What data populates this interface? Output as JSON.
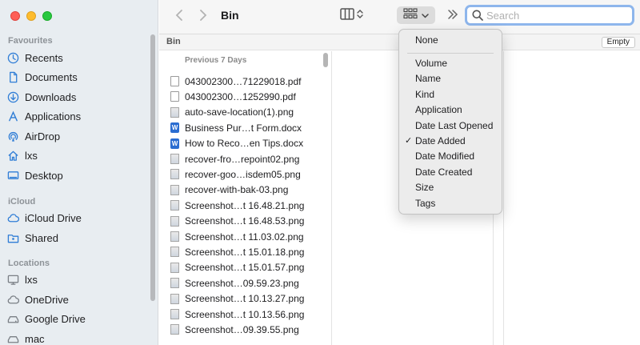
{
  "window": {
    "title": "Bin"
  },
  "sidebar": {
    "sections": [
      {
        "title": "Favourites",
        "items": [
          {
            "label": "Recents",
            "icon": "clock-icon"
          },
          {
            "label": "Documents",
            "icon": "document-icon"
          },
          {
            "label": "Downloads",
            "icon": "download-icon"
          },
          {
            "label": "Applications",
            "icon": "applications-icon"
          },
          {
            "label": "AirDrop",
            "icon": "airdrop-icon"
          },
          {
            "label": "lxs",
            "icon": "home-icon"
          },
          {
            "label": "Desktop",
            "icon": "desktop-icon"
          }
        ]
      },
      {
        "title": "iCloud",
        "items": [
          {
            "label": "iCloud Drive",
            "icon": "cloud-icon"
          },
          {
            "label": "Shared",
            "icon": "shared-folder-icon"
          }
        ]
      },
      {
        "title": "Locations",
        "items": [
          {
            "label": "lxs",
            "icon": "computer-icon"
          },
          {
            "label": "OneDrive",
            "icon": "cloud-icon"
          },
          {
            "label": "Google Drive",
            "icon": "drive-icon"
          },
          {
            "label": "mac",
            "icon": "disk-icon"
          }
        ]
      }
    ]
  },
  "toolbar": {
    "search_placeholder": "Search",
    "search_value": ""
  },
  "pathbar": {
    "label": "Bin",
    "empty_button": "Empty"
  },
  "file_list": {
    "group_header": "Previous 7 Days",
    "files": [
      {
        "name": "043002300…71229018.pdf",
        "type": "pdf"
      },
      {
        "name": "043002300…1252990.pdf",
        "type": "pdf"
      },
      {
        "name": "auto-save-location(1).png",
        "type": "img"
      },
      {
        "name": "Business Pur…t Form.docx",
        "type": "word"
      },
      {
        "name": "How to Reco…en Tips.docx",
        "type": "word"
      },
      {
        "name": "recover-fro…repoint02.png",
        "type": "img"
      },
      {
        "name": "recover-goo…isdem05.png",
        "type": "img"
      },
      {
        "name": "recover-with-bak-03.png",
        "type": "img"
      },
      {
        "name": "Screenshot…t 16.48.21.png",
        "type": "img"
      },
      {
        "name": "Screenshot…t 16.48.53.png",
        "type": "img"
      },
      {
        "name": "Screenshot…t 11.03.02.png",
        "type": "img"
      },
      {
        "name": "Screenshot…t 15.01.18.png",
        "type": "img"
      },
      {
        "name": "Screenshot…t 15.01.57.png",
        "type": "img"
      },
      {
        "name": "Screenshot…09.59.23.png",
        "type": "img"
      },
      {
        "name": "Screenshot…t 10.13.27.png",
        "type": "img"
      },
      {
        "name": "Screenshot…t 10.13.56.png",
        "type": "img"
      },
      {
        "name": "Screenshot…09.39.55.png",
        "type": "img"
      }
    ]
  },
  "group_menu": {
    "top_item": "None",
    "items": [
      "Volume",
      "Name",
      "Kind",
      "Application",
      "Date Last Opened",
      "Date Added",
      "Date Modified",
      "Date Created",
      "Size",
      "Tags"
    ],
    "checked": "Date Added",
    "check_glyph": "✓"
  }
}
